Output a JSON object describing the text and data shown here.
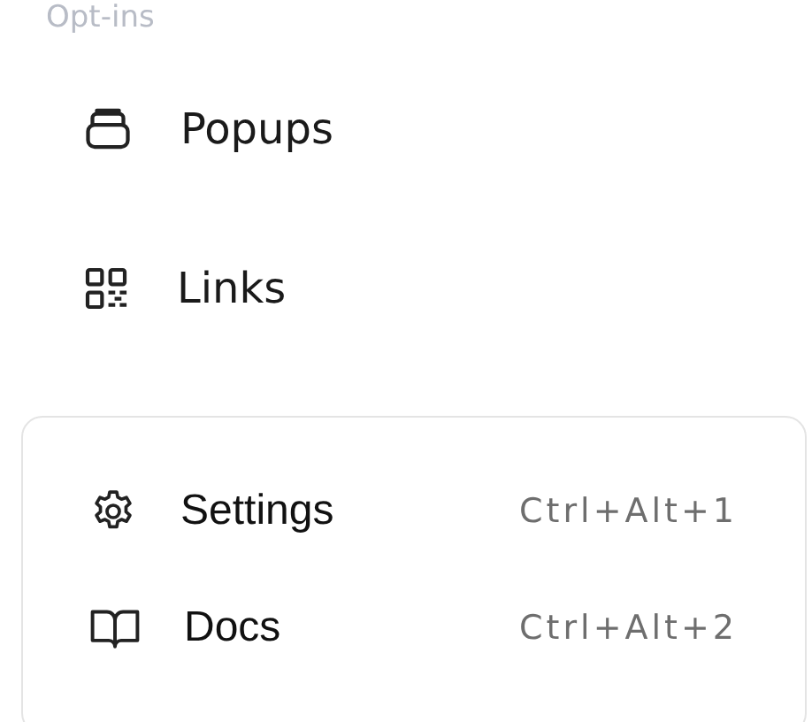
{
  "section_heading": "Opt-ins",
  "nav_items": [
    {
      "label": "Popups"
    },
    {
      "label": "Links"
    }
  ],
  "menu": [
    {
      "label": "Settings",
      "shortcut": "Ctrl+Alt+1"
    },
    {
      "label": "Docs",
      "shortcut": "Ctrl+Alt+2"
    }
  ]
}
